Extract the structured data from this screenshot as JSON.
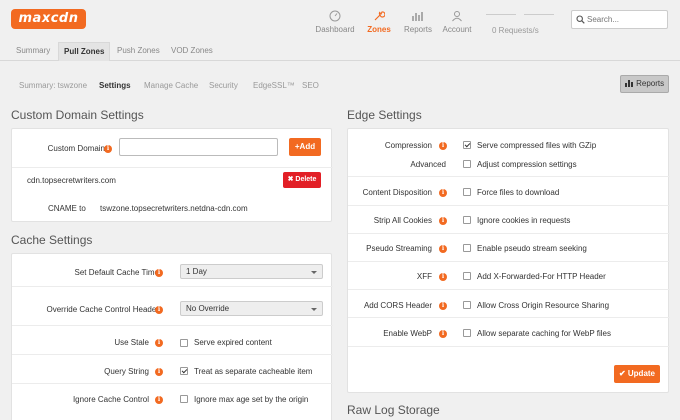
{
  "brand": {
    "logo_text": "maxcdn",
    "accent": "#f26a21"
  },
  "nav": [
    {
      "label": "Dashboard",
      "icon": "dashboard-icon"
    },
    {
      "label": "Zones",
      "icon": "wrench-icon",
      "active": true
    },
    {
      "label": "Reports",
      "icon": "bar-chart-icon"
    },
    {
      "label": "Account",
      "icon": "user-icon"
    }
  ],
  "requests": "0 Requests/s",
  "search": {
    "placeholder": "Search..."
  },
  "tabs": [
    "Summary",
    "Pull Zones",
    "Push Zones",
    "VOD Zones"
  ],
  "subtabs": [
    "Summary: tswzone",
    "Settings",
    "Manage Cache",
    "Security",
    "EdgeSSL™",
    "SEO"
  ],
  "reports_button": "Reports",
  "custom_domain": {
    "title": "Custom Domain Settings",
    "label": "Custom Domains",
    "add_label": "+Add",
    "domain": "cdn.topsecretwriters.com",
    "delete_label": "✖ Delete",
    "cname_label": "CNAME to",
    "cname_value": "tswzone.topsecretwriters.netdna-cdn.com"
  },
  "cache": {
    "title": "Cache Settings",
    "default_time_label": "Set Default Cache Time",
    "default_time_value": "1 Day",
    "override_label": "Override Cache Control Header",
    "override_value": "No Override",
    "use_stale_label": "Use Stale",
    "use_stale_text": "Serve expired content",
    "use_stale_checked": false,
    "query_string_label": "Query String",
    "query_string_text": "Treat as separate cacheable item",
    "query_string_checked": true,
    "ignore_cc_label": "Ignore Cache Control",
    "ignore_cc_text": "Ignore max age set by the origin",
    "ignore_cc_checked": false
  },
  "edge": {
    "title": "Edge Settings",
    "compression_label": "Compression",
    "compression_text": "Serve compressed files with GZip",
    "compression_checked": true,
    "advanced_label": "Advanced",
    "advanced_text": "Adjust compression settings",
    "disposition_label": "Content Disposition",
    "disposition_text": "Force files to download",
    "strip_label": "Strip All Cookies",
    "strip_text": "Ignore cookies in requests",
    "pseudo_label": "Pseudo Streaming",
    "pseudo_text": "Enable pseudo stream seeking",
    "xff_label": "XFF",
    "xff_text": "Add X-Forwarded-For HTTP Header",
    "cors_label": "Add CORS Header",
    "cors_text": "Allow Cross Origin Resource Sharing",
    "webp_label": "Enable WebP",
    "webp_text": "Allow separate caching for WebP files",
    "update_label": "✔ Update"
  },
  "raw_log": {
    "title": "Raw Log Storage"
  }
}
